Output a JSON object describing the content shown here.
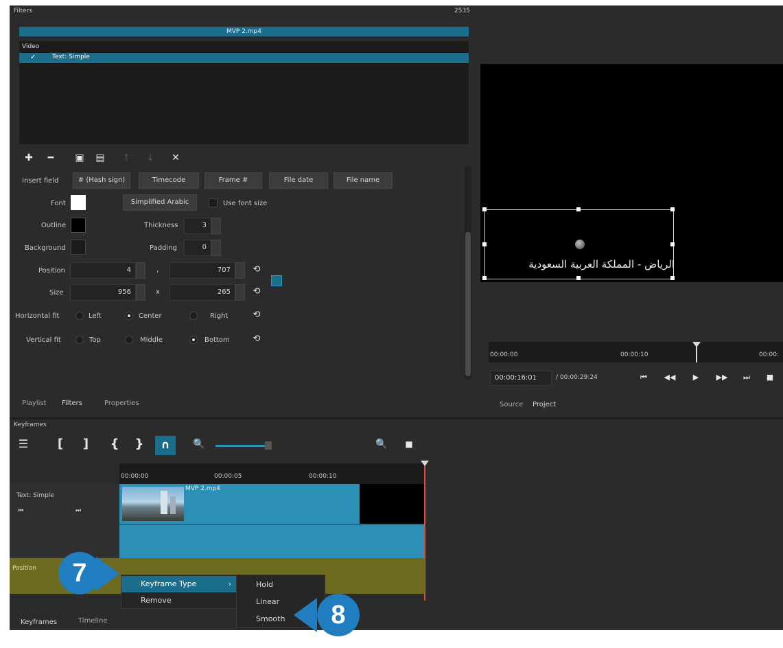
{
  "filters_panel": {
    "title": "Filters",
    "counter": "2535",
    "clip_name": "MVP 2.mp4",
    "video_section": "Video",
    "filter_item": "Text: Simple",
    "insert_field_label": "Insert field",
    "insert_buttons": [
      "# (Hash sign)",
      "Timecode",
      "Frame #",
      "File date",
      "File name"
    ],
    "font_label": "Font",
    "simplified_arabic_button": "Simplified Arabic",
    "use_font_size_label": "Use font size",
    "outline_label": "Outline",
    "thickness_label": "Thickness",
    "thickness_value": "3",
    "background_label": "Background",
    "padding_label": "Padding",
    "padding_value": "0",
    "position_label": "Position",
    "position_x": "4",
    "position_y": "707",
    "size_label": "Size",
    "size_w": "956",
    "size_h": "265",
    "x_sep": "x",
    "pos_sep": ",",
    "horizontal_fit_label": "Horizontal fit",
    "h_options": [
      "Left",
      "Center",
      "Right"
    ],
    "vertical_fit_label": "Vertical fit",
    "v_options": [
      "Top",
      "Middle",
      "Bottom"
    ],
    "bottom_tabs": [
      "Playlist",
      "Filters",
      "Properties"
    ]
  },
  "player": {
    "overlay_text": "الرياض - المملكة العربية السعودية",
    "ruler_labels": [
      "00:00:00",
      "00:00:10",
      "00:00:"
    ],
    "current_time": "00:00:16:01",
    "total_time": "/ 00:00:29:24",
    "tabs": [
      "Source",
      "Project"
    ]
  },
  "keyframes": {
    "title": "Keyframes",
    "ruler_labels": [
      "00:00:00",
      "00:00:05",
      "00:00:10"
    ],
    "track_name": "Text: Simple",
    "clip_name": "MVP 2.mp4",
    "param_name": "Position",
    "context_menu": {
      "keyframe_type": "Keyframe Type",
      "remove": "Remove"
    },
    "submenu": [
      "Hold",
      "Linear",
      "Smooth"
    ],
    "bottom_tabs": [
      "Keyframes",
      "Timeline"
    ]
  },
  "callouts": {
    "step7": "7",
    "step8": "8"
  },
  "colors": {
    "accent": "#1a6e8c",
    "clip": "#2b8fb6",
    "param_track": "#6e6a22",
    "callout": "#1f7dc0"
  }
}
